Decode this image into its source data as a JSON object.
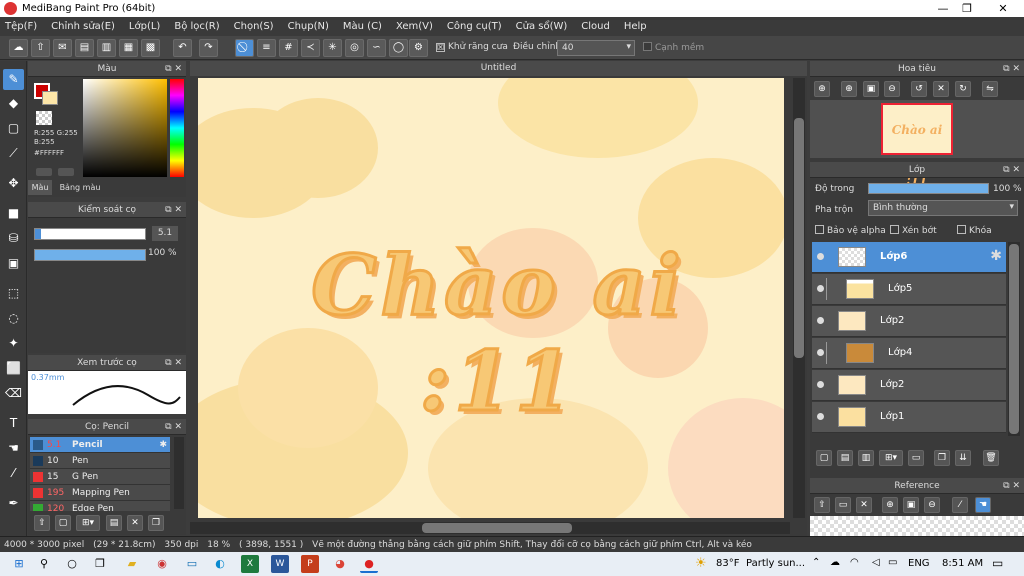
{
  "window": {
    "title": "MediBang Paint Pro (64bit)",
    "minimize": "—",
    "maximize": "❐",
    "close": "✕"
  },
  "menu": [
    "Tệp(F)",
    "Chỉnh sửa(E)",
    "Lớp(L)",
    "Bộ lọc(R)",
    "Chọn(S)",
    "Chụp(N)",
    "Màu (C)",
    "Xem(V)",
    "Công cụ(T)",
    "Cửa sổ(W)",
    "Cloud",
    "Help"
  ],
  "toolbar": {
    "antialias_label": "Khử răng cưa",
    "adjust_label": "Điều chỉnh",
    "adjust_value": "40",
    "edge_label": "Cạnh mềm",
    "antialias_check": "☒"
  },
  "color_panel": {
    "title": "Màu",
    "rgb": "R:255 G:255 B:255",
    "hex": "#FFFFFF",
    "tab_color": "Màu",
    "tab_palette": "Bảng màu",
    "close": "✕",
    "detach": "⧉"
  },
  "brush_control": {
    "title": "Kiểm soát cọ",
    "size": "5.1",
    "opacity": "100 %",
    "opacity_fraction": 1.0,
    "size_fraction": 0.05
  },
  "preview": {
    "title": "Xem trước cọ",
    "size": "0.37mm"
  },
  "brush_list": {
    "title": "Cọ: Pencil",
    "items": [
      {
        "size": "5.1",
        "name": "Pencil",
        "color": "#2a5a8a",
        "selected": true
      },
      {
        "size": "10",
        "name": "Pen",
        "color": "#1a3a5a",
        "selected": false
      },
      {
        "size": "15",
        "name": "G Pen",
        "color": "#d22",
        "selected": false
      },
      {
        "size": "195",
        "name": "Mapping Pen",
        "color": "#d22",
        "selected": false
      },
      {
        "size": "120",
        "name": "Edge Pen",
        "color": "#d22",
        "selected": false
      }
    ]
  },
  "canvas": {
    "tab_title": "Untitled",
    "artwork_text": "Chào ai :11"
  },
  "navigator": {
    "title": "Hoa tiêu",
    "thumb_text": "Chào ai :11"
  },
  "layer_panel": {
    "title": "Lớp",
    "opacity_label": "Độ trong",
    "opacity_value": "100 %",
    "opacity_fraction": 1.0,
    "blend_label": "Pha trộn",
    "blend_value": "Bình thường",
    "protect_alpha": "Bảo vệ alpha",
    "clip": "Xén bớt",
    "lock": "Khóa"
  },
  "layers": [
    {
      "name": "Lớp6",
      "selected": true
    },
    {
      "name": "Lớp5",
      "selected": false
    },
    {
      "name": "Lớp2",
      "selected": false
    },
    {
      "name": "Lớp4",
      "selected": false
    },
    {
      "name": "Lớp2",
      "selected": false
    },
    {
      "name": "Lớp1",
      "selected": false
    }
  ],
  "reference": {
    "title": "Reference"
  },
  "statusbar": {
    "size": "4000 * 3000 pixel",
    "cm": "(29 * 21.8cm)",
    "dpi": "350 dpi",
    "zoom": "18 %",
    "coords": "( 3898, 1551 )",
    "hint": "Vẽ một đường thẳng bằng cách giữ phím Shift, Thay đổi cỡ cọ bằng cách giữ phím Ctrl, Alt và kéo"
  },
  "taskbar": {
    "weather_temp": "83°F",
    "weather_text": "Partly sun...",
    "lang": "ENG",
    "time": "8:51 AM"
  },
  "colors": {
    "accent": "#4d8fd6",
    "canvas_bg": "#fdefc8",
    "panel": "#3a3a3a"
  }
}
